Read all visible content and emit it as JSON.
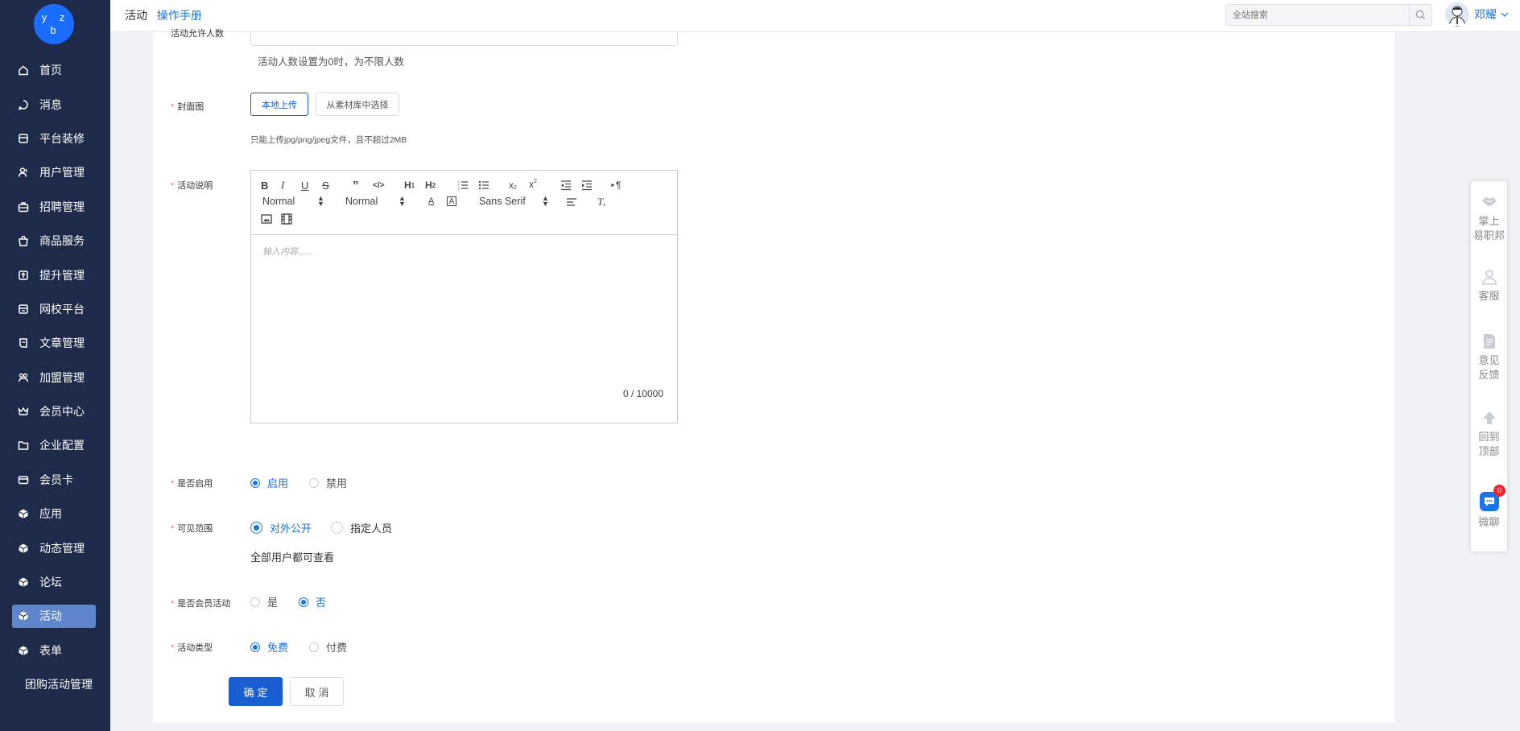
{
  "logo": "y z b",
  "sidebar": {
    "items": [
      {
        "label": "首页",
        "icon": "home-icon"
      },
      {
        "label": "消息",
        "icon": "message-icon"
      },
      {
        "label": "平台装修",
        "icon": "store-icon"
      },
      {
        "label": "用户管理",
        "icon": "user-icon"
      },
      {
        "label": "招聘管理",
        "icon": "briefcase-icon"
      },
      {
        "label": "商品服务",
        "icon": "bag-icon"
      },
      {
        "label": "提升管理",
        "icon": "upgrade-icon"
      },
      {
        "label": "网校平台",
        "icon": "school-icon"
      },
      {
        "label": "文章管理",
        "icon": "article-icon"
      },
      {
        "label": "加盟管理",
        "icon": "team-icon"
      },
      {
        "label": "会员中心",
        "icon": "crown-icon"
      },
      {
        "label": "企业配置",
        "icon": "folder-icon"
      },
      {
        "label": "会员卡",
        "icon": "card-icon"
      },
      {
        "label": "应用",
        "icon": "cube-icon"
      },
      {
        "label": "动态管理",
        "icon": "cube-icon"
      },
      {
        "label": "论坛",
        "icon": "cube-icon"
      },
      {
        "label": "活动",
        "icon": "cube-icon",
        "active": true
      },
      {
        "label": "表单",
        "icon": "cube-icon"
      },
      {
        "label": "团购活动管理",
        "icon": "",
        "sub": true
      }
    ]
  },
  "header": {
    "breadcrumb_current": "活动",
    "manual_link": "操作手册",
    "search_placeholder": "全站搜索",
    "user_name": "邓耀"
  },
  "form": {
    "participants_label_partial": "活动允许人数",
    "participants_help": "活动人数设置为0时，为不限人数",
    "cover_label": "封面图",
    "upload_local": "本地上传",
    "choose_library": "从素材库中选择",
    "upload_hint": "只能上传jpg/png/jpeg文件，且不超过2MB",
    "desc_label": "活动说明",
    "editor": {
      "size_select": "Normal",
      "header_select": "Normal",
      "font_select": "Sans Serif",
      "placeholder": "输入内容......",
      "counter": "0 / 10000"
    },
    "enable_label": "是否启用",
    "enable_on": "启用",
    "enable_off": "禁用",
    "scope_label": "可见范围",
    "scope_public": "对外公开",
    "scope_specified": "指定人员",
    "scope_help": "全部用户都可查看",
    "member_label": "是否会员活动",
    "member_yes": "是",
    "member_no": "否",
    "type_label": "活动类型",
    "type_free": "免费",
    "type_paid": "付费",
    "confirm": "确定",
    "cancel": "取消"
  },
  "float_panel": {
    "mobile": "掌上易职邦",
    "service": "客服",
    "feedback": "意见反馈",
    "top": "回到顶部",
    "chat": "微聊",
    "chat_badge": "0"
  },
  "colors": {
    "sidebar_bg": "#1e2a4a",
    "accent": "#1a73e8",
    "primary_button": "#1a5fd1",
    "active_item": "#5e86cc",
    "required": "#f56c6c"
  }
}
